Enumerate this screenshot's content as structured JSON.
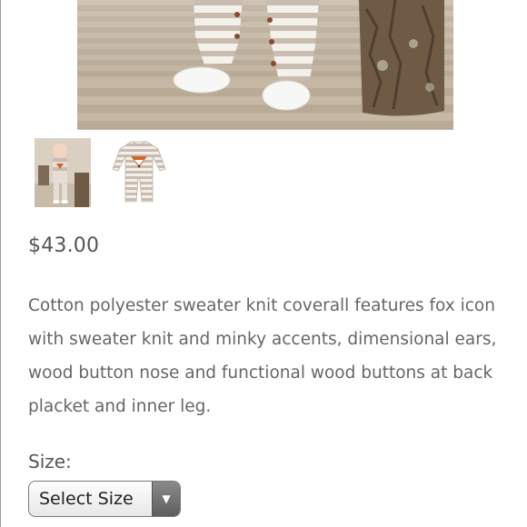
{
  "product": {
    "price": "$43.00",
    "description": "Cotton polyester sweater knit coverall features fox icon with sweater knit and minky accents, dimensional ears, wood button nose and functional wood buttons at back placket and inner leg."
  },
  "size_selector": {
    "label": "Size:",
    "selected": "Select Size",
    "arrow_icon": "triangle-down-icon"
  },
  "colors": {
    "text": "#555555",
    "select_border": "#7a7a7a",
    "arrow_bg": "#6a6a6a"
  }
}
